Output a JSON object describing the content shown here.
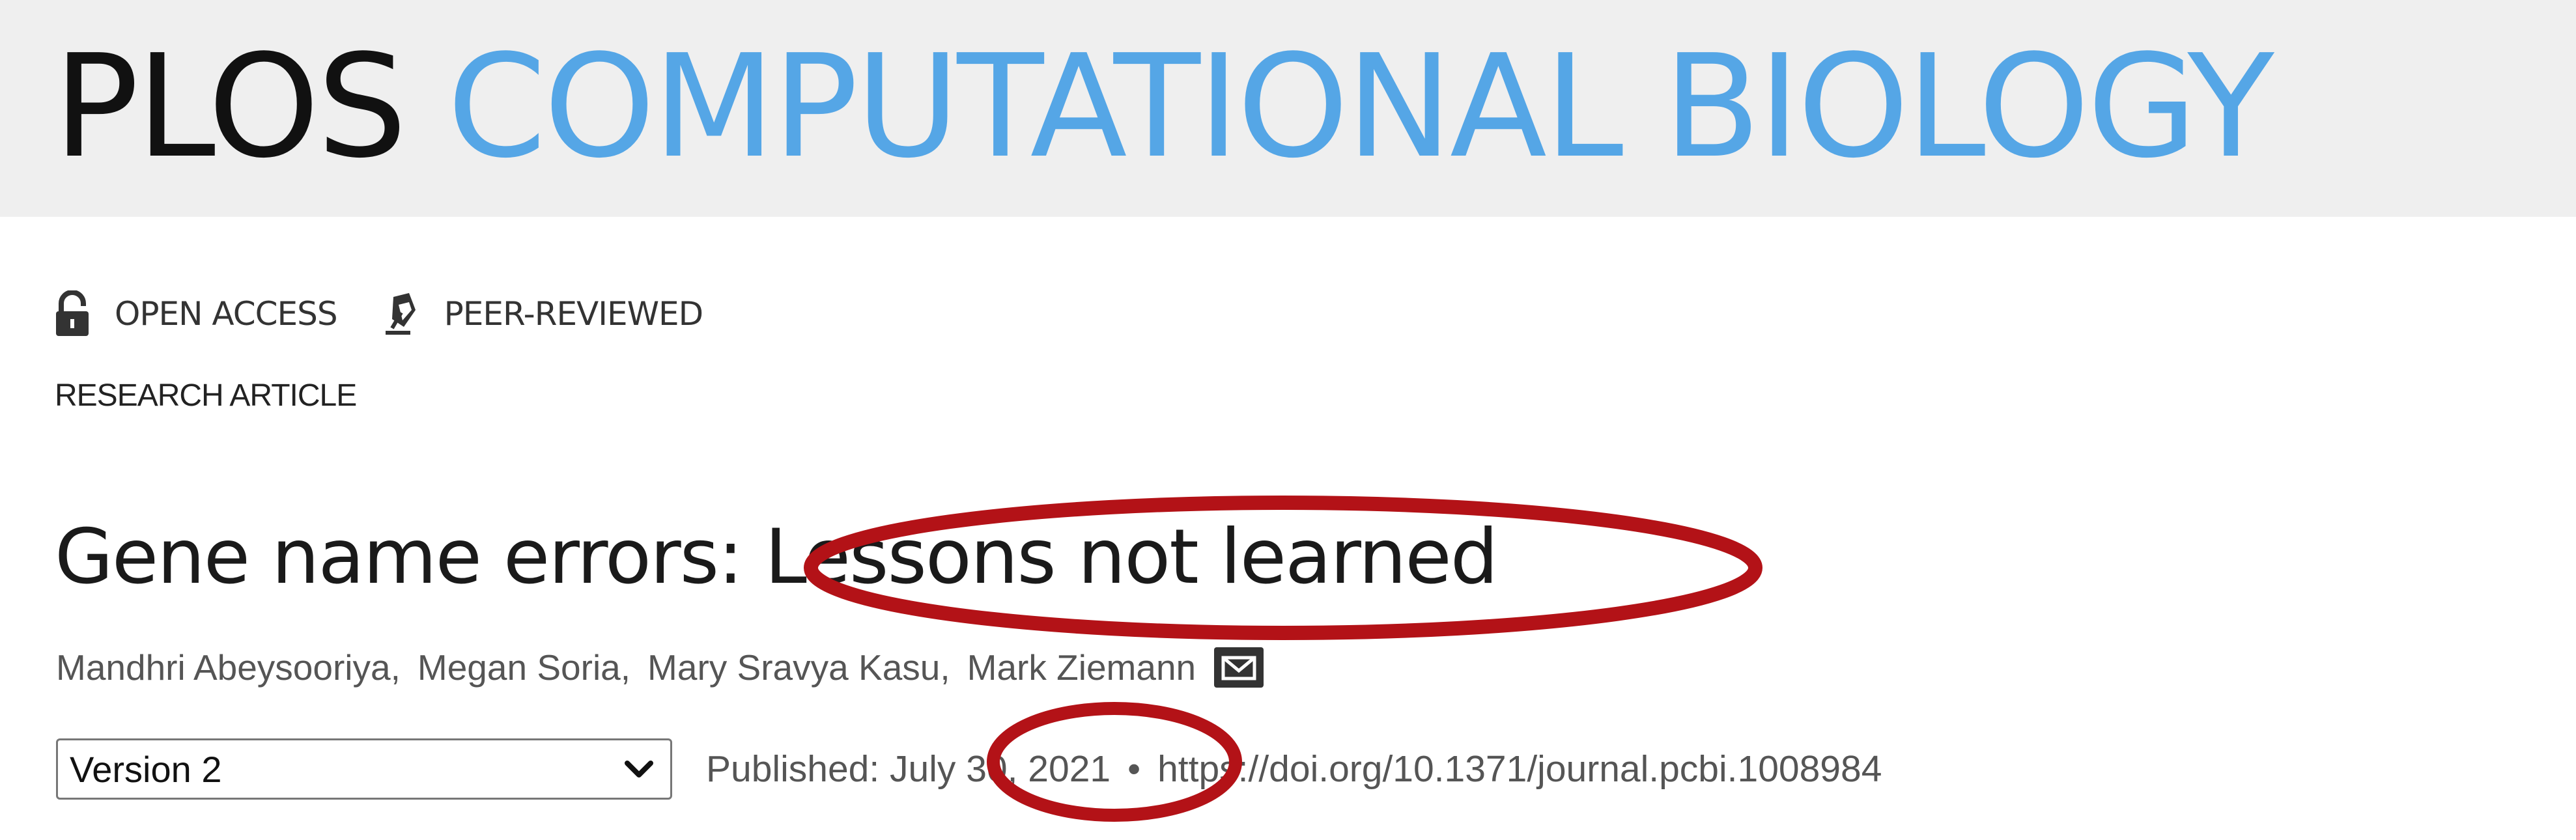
{
  "masthead": {
    "publisher": "PLOS",
    "journal": "COMPUTATIONAL BIOLOGY"
  },
  "badges": [
    {
      "label": "OPEN ACCESS",
      "icon": "unlock-icon"
    },
    {
      "label": "PEER-REVIEWED",
      "icon": "pen-nib-icon"
    }
  ],
  "article": {
    "type": "RESEARCH ARTICLE",
    "title": "Gene name errors: Lessons not learned",
    "authors": [
      {
        "name": "Mandhri Abeysooriya,"
      },
      {
        "name": "Megan Soria,"
      },
      {
        "name": "Mary Sravya Kasu,"
      },
      {
        "name": "Mark Ziemann"
      }
    ],
    "contact_icon": "envelope-icon"
  },
  "meta": {
    "version_selected": "Version 2",
    "published": "Published: July 30, 2021",
    "separator": "•",
    "doi": "https://doi.org/10.1371/journal.pcbi.1008984"
  },
  "colors": {
    "masthead_bg": "#efefef",
    "journal_blue": "#55a6e6",
    "annotation_red": "#b31217"
  }
}
